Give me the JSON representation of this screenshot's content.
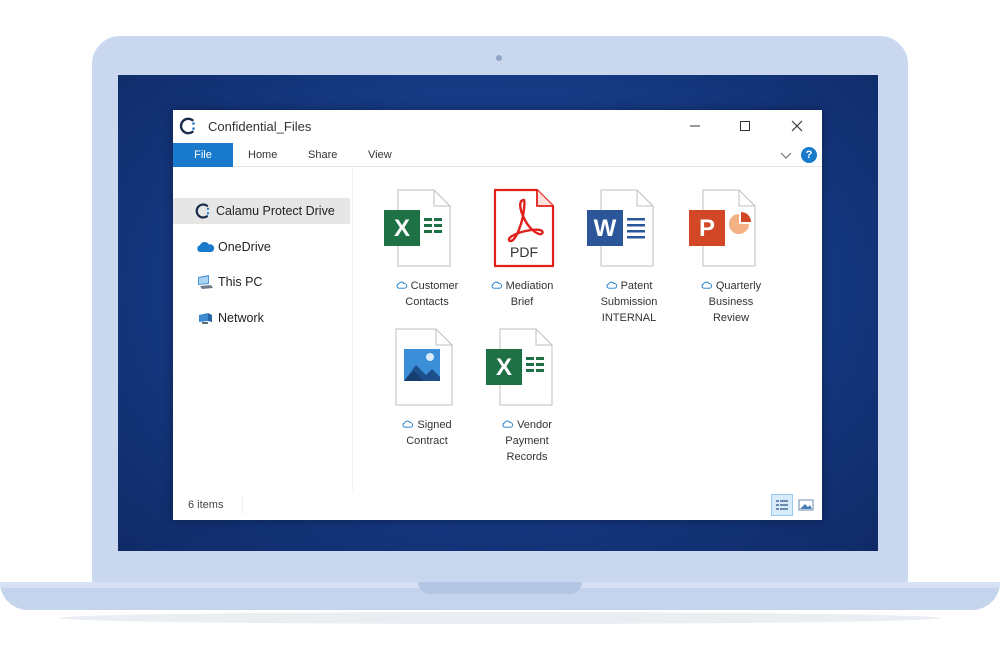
{
  "window": {
    "title": "Confidential_Files"
  },
  "ribbon": {
    "tabs": [
      {
        "label": "File"
      },
      {
        "label": "Home"
      },
      {
        "label": "Share"
      },
      {
        "label": "View"
      }
    ],
    "help_label": "?"
  },
  "nav": {
    "items": [
      {
        "label": "Calamu Protect Drive",
        "icon": "calamu-logo-icon",
        "selected": true
      },
      {
        "label": "OneDrive",
        "icon": "onedrive-cloud-icon"
      },
      {
        "label": "This PC",
        "icon": "this-pc-icon"
      },
      {
        "label": "Network",
        "icon": "network-icon"
      }
    ]
  },
  "files": [
    {
      "type": "excel",
      "glyph": "X",
      "line1": "Customer",
      "line2": "Contacts",
      "line3": ""
    },
    {
      "type": "pdf",
      "glyph": "PDF",
      "line1": "Mediation",
      "line2": "Brief",
      "line3": ""
    },
    {
      "type": "word",
      "glyph": "W",
      "line1": "Patent",
      "line2": "Submission",
      "line3": "INTERNAL"
    },
    {
      "type": "powerpoint",
      "glyph": "P",
      "line1": "Quarterly",
      "line2": "Business",
      "line3": "Review"
    },
    {
      "type": "image",
      "glyph": "",
      "line1": "Signed",
      "line2": "Contract",
      "line3": ""
    },
    {
      "type": "excel",
      "glyph": "X",
      "line1": "Vendor",
      "line2": "Payment",
      "line3": "Records"
    }
  ],
  "status": {
    "item_count": "6 items"
  },
  "colors": {
    "accent": "#1979ca",
    "excel": "#1e7145",
    "word": "#2b579a",
    "powerpoint": "#d24726",
    "pdf": "#e0211b",
    "onedrive": "#1979ca",
    "desktop": "#173d8a",
    "laptop": "#c9d8ef"
  }
}
